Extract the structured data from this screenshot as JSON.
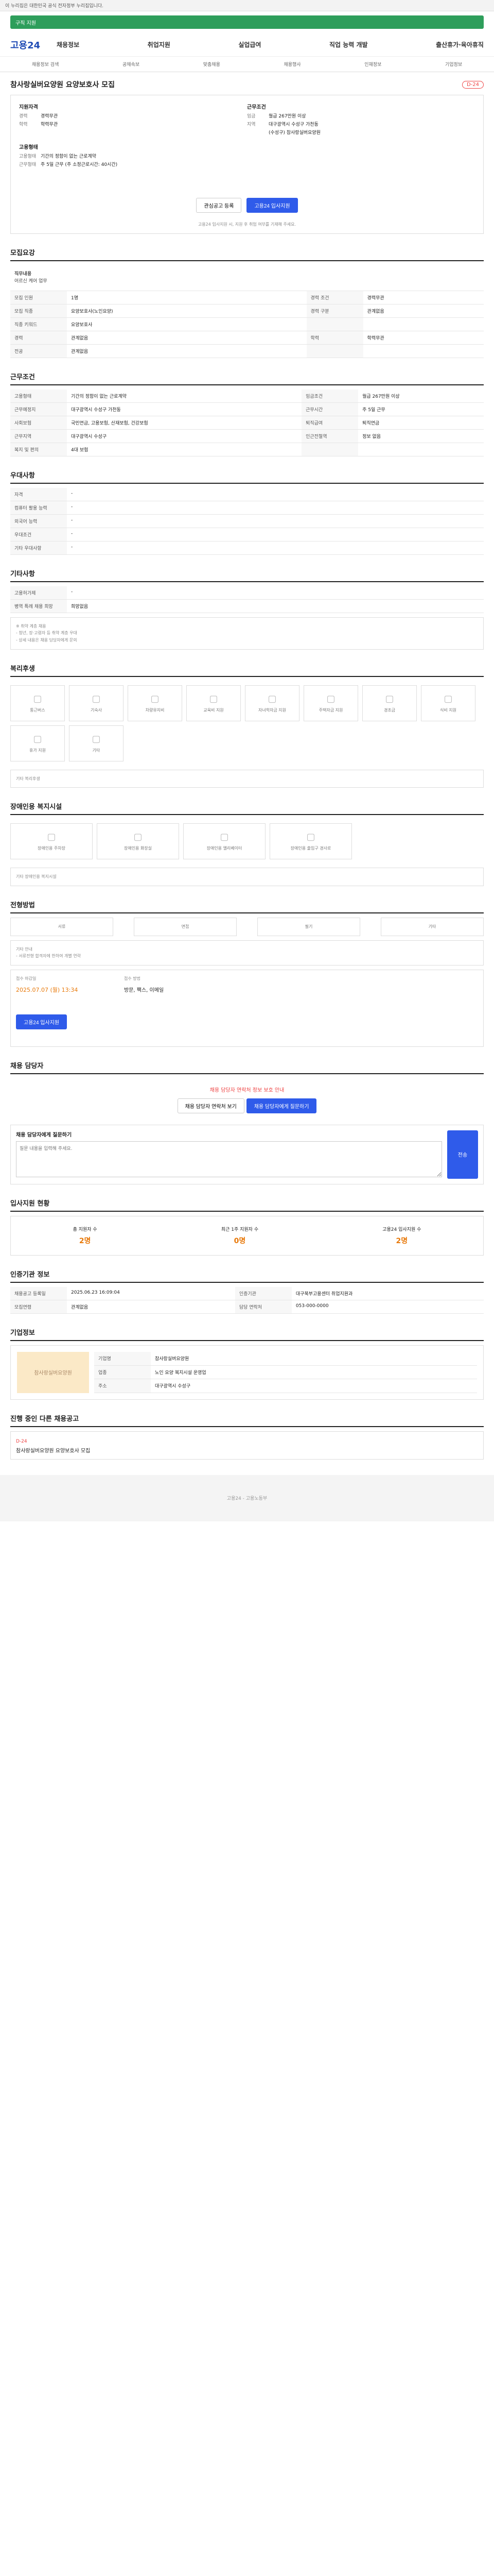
{
  "topbar": {
    "label": "이 누리집은 대한민국 공식 전자정부 누리집입니다."
  },
  "greenbar": {
    "title": "구직 지원"
  },
  "header": {
    "logo": "고용24",
    "nav": [
      "채용정보",
      "취업지원",
      "실업급여",
      "직업 능력 개발",
      "출산휴가·육아휴직"
    ]
  },
  "subnav": [
    "채용정보 검색",
    "공채속보",
    "맞춤채용",
    "채용행사",
    "인재정보",
    "기업정보"
  ],
  "job": {
    "title": "참사랑실버요양원 요양보호사 모집",
    "dday": "D-24",
    "left_title": "지원자격",
    "left": [
      {
        "k": "경력",
        "v": "경력무관"
      },
      {
        "k": "학력",
        "v": "학력무관"
      }
    ],
    "right_title": "근무조건",
    "right": [
      {
        "k": "임금",
        "v": "월급 267만원 이상"
      },
      {
        "k": "지역",
        "v": "대구광역시 수성구 가천동"
      },
      {
        "k": "",
        "v": "(수성구) 참사랑실버요양원"
      }
    ],
    "left2_title": "고용형태",
    "left2": [
      {
        "k": "고용형태",
        "v": "기간의 정함이 없는 근로계약"
      },
      {
        "k": "근무형태",
        "v": "주 5일 근무 (주 소정근로시간: 40시간)"
      }
    ],
    "save_label": "관심공고 등록",
    "apply_label": "고용24 입사지원",
    "note": "고용24 입사지원 시, 지원 후 취업 여부를 기재해 주세요."
  },
  "recruit": {
    "heading": "모집요강",
    "job_title": "직무내용",
    "job_desc": "어르신 케어 업무",
    "rows": [
      [
        "모집 인원",
        "1명",
        "경력 조건",
        "경력무관"
      ],
      [
        "모집 직종",
        "요양보호사(노인요양)",
        "경력 구분",
        "관계없음"
      ],
      [
        "직종 키워드",
        "요양보호사",
        "",
        ""
      ],
      [
        "경력",
        "관계없음",
        "학력",
        "학력무관"
      ],
      [
        "전공",
        "관계없음",
        "",
        ""
      ]
    ]
  },
  "condition": {
    "heading": "근무조건",
    "rows": [
      [
        "고용형태",
        "기간의 정함이 없는 근로계약",
        "임금조건",
        "월급 267만원 이상"
      ],
      [
        "근무예정지",
        "대구광역시 수성구 가천동",
        "근무시간",
        "주 5일 근무"
      ],
      [
        "사회보험",
        "국민연금, 고용보험, 산재보험, 건강보험",
        "퇴직급여",
        "퇴직연금"
      ],
      [
        "근무지역",
        "대구광역시 수성구",
        "인근전철역",
        "정보 없음"
      ],
      [
        "복지 및 편의",
        "4대 보험",
        "",
        ""
      ]
    ]
  },
  "pref": {
    "heading": "우대사항",
    "rows": [
      [
        "자격",
        "-"
      ],
      [
        "컴퓨터 활용 능력",
        "-"
      ],
      [
        "외국어 능력",
        "-"
      ],
      [
        "우대조건",
        "-"
      ],
      [
        "기타 우대사항",
        "-"
      ]
    ]
  },
  "other": {
    "heading": "기타사항",
    "rows": [
      [
        "고용허가제",
        "-"
      ],
      [
        "병역 특례 채용 희망",
        "희망없음"
      ]
    ],
    "note_title": "※ 취약 계층 채용",
    "notes": [
      "- 청년, 장·고령자 등 취약 계층 우대",
      "- 상세 내용은 채용 담당자에게 문의"
    ]
  },
  "welfare": {
    "heading": "복리후생",
    "items": [
      "통근버스",
      "기숙사",
      "차량유지비",
      "교육비 지원",
      "자녀학자금 지원",
      "주택자금 지원",
      "경조금",
      "식비 지원",
      "휴가 지원",
      "기타"
    ],
    "extra_label": "기타 복리후생"
  },
  "facility": {
    "heading": "장애인용 복지시설",
    "items": [
      "장애인용 주차장",
      "장애인용 화장실",
      "장애인용 엘리베이터",
      "장애인용 출입구 경사로"
    ],
    "extra_label": "기타 장애인용 복지시설"
  },
  "docs": {
    "heading": "전형방법",
    "methods": [
      "서류",
      "면접",
      "필기",
      "기타"
    ],
    "guide_title": "기타 안내",
    "guide": "- 서류전형 합격자에 한하여 개별 연락",
    "deadline_label": "접수 마감일",
    "deadline": "2025.07.07 (월) 13:34",
    "method_label": "접수 방법",
    "method": "방문, 팩스, 이메일",
    "apply_btn": "고용24 입사지원"
  },
  "contact": {
    "heading": "채용 담당자",
    "notice": "채용 담당자 연락처 정보 보호 안내",
    "btn1": "채용 담당자 연락처 보기",
    "btn2": "채용 담당자에게 질문하기",
    "q_title": "채용 담당자에게 질문하기",
    "q_placeholder": "질문 내용을 입력해 주세요.",
    "send": "전송"
  },
  "status": {
    "heading": "입사지원 현황",
    "items": [
      {
        "label": "총 지원자 수",
        "value": "2명"
      },
      {
        "label": "최근 1주 지원자 수",
        "value": "0명"
      },
      {
        "label": "고용24 입사지원 수",
        "value": "2명"
      }
    ]
  },
  "cert": {
    "heading": "인증기관 정보",
    "rows": [
      [
        "채용공고 등록일",
        "2025.06.23 16:09:04",
        "인증기관",
        "대구북부고용센터 취업지원과"
      ],
      [
        "모집연령",
        "관계없음",
        "담당 연락처",
        "053-000-0000"
      ]
    ]
  },
  "company": {
    "heading": "기업정보",
    "name": "참사랑실버요양원",
    "rows": [
      [
        "기업명",
        "참사랑실버요양원"
      ],
      [
        "업종",
        "노인 요양 복지시설 운영업"
      ],
      [
        "주소",
        "대구광역시 수성구"
      ]
    ]
  },
  "similar": {
    "heading": "진행 중인 다른 채용공고",
    "items": [
      {
        "dday": "D-24",
        "title": "참사랑실버요양원 요양보호사 모집"
      }
    ]
  },
  "footer": {
    "text": "고용24 - 고용노동부"
  }
}
